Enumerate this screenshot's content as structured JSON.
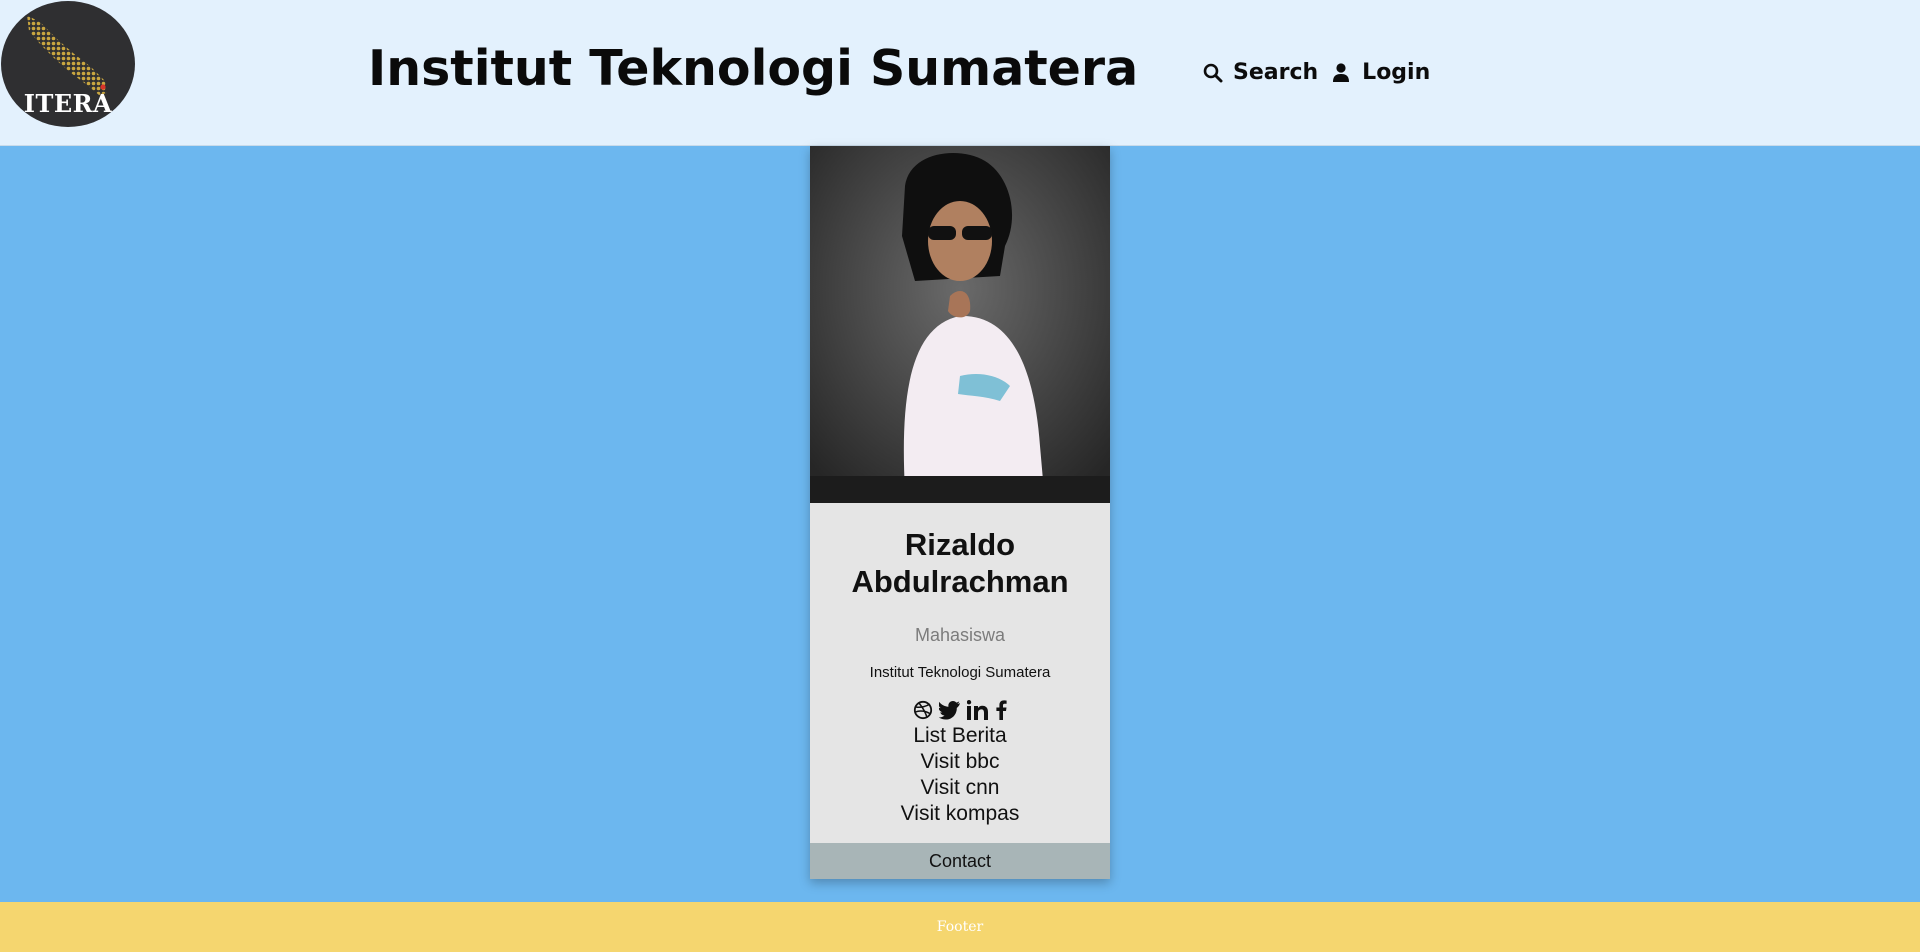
{
  "header": {
    "logo_text": "ITERA",
    "title": "Institut Teknologi Sumatera",
    "nav": [
      {
        "label": "Search",
        "icon": "search-icon"
      },
      {
        "label": "Login",
        "icon": "user-icon"
      }
    ]
  },
  "card": {
    "photo_alt": "Rizaldo Abdulrachman",
    "name": "Rizaldo Abdulrachman",
    "role": "Mahasiswa",
    "organization": "Institut Teknologi Sumatera",
    "social_icons": [
      "dribbble-icon",
      "twitter-icon",
      "linkedin-icon",
      "facebook-icon"
    ],
    "links": [
      "List Berita",
      "Visit bbc",
      "Visit cnn",
      "Visit kompas"
    ],
    "contact_label": "Contact"
  },
  "footer": {
    "text": "Footer"
  },
  "colors": {
    "page_background": "#6cb7ef",
    "header_background": "#e3f1fd",
    "card_background": "#e5e5e5",
    "contact_button": "#a8b5b7",
    "footer_background": "#f5d66f"
  }
}
